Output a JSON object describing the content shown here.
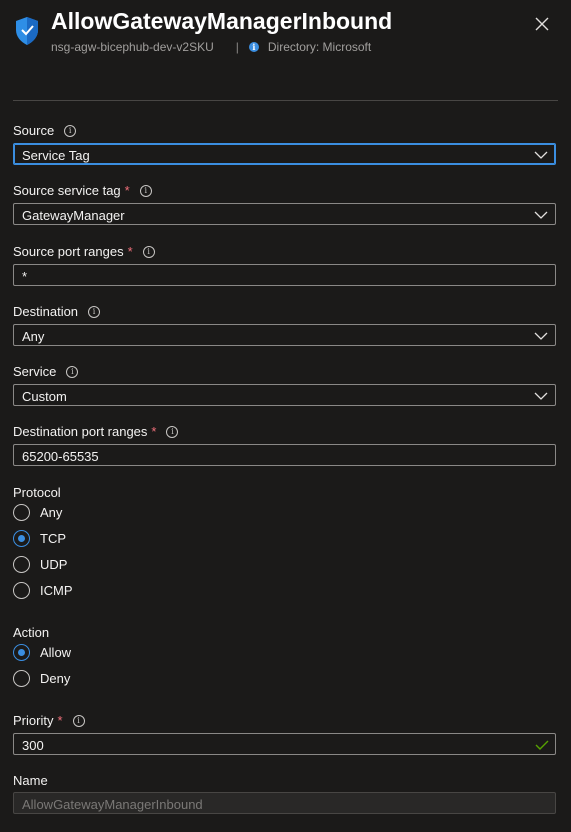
{
  "header": {
    "title": "AllowGatewayManagerInbound",
    "resource": "nsg-agw-bicephub-dev-v2SKU",
    "separator": "|",
    "directory": "Directory: Microsoft"
  },
  "form": {
    "source": {
      "label": "Source",
      "value": "Service Tag"
    },
    "source_service_tag": {
      "label": "Source service tag",
      "required": "*",
      "value": "GatewayManager"
    },
    "source_port_ranges": {
      "label": "Source port ranges",
      "required": "*",
      "value": "*"
    },
    "destination": {
      "label": "Destination",
      "value": "Any"
    },
    "service": {
      "label": "Service",
      "value": "Custom"
    },
    "destination_port_ranges": {
      "label": "Destination port ranges",
      "required": "*",
      "value": "65200-65535"
    },
    "protocol": {
      "label": "Protocol",
      "options": [
        "Any",
        "TCP",
        "UDP",
        "ICMP"
      ],
      "selected": "TCP"
    },
    "action": {
      "label": "Action",
      "options": [
        "Allow",
        "Deny"
      ],
      "selected": "Allow"
    },
    "priority": {
      "label": "Priority",
      "required": "*",
      "value": "300"
    },
    "name": {
      "label": "Name",
      "value": "AllowGatewayManagerInbound"
    }
  },
  "colors": {
    "background": "#1b1a19",
    "accent": "#3b8ee0",
    "required": "#f1707b",
    "valid": "#57a300"
  }
}
